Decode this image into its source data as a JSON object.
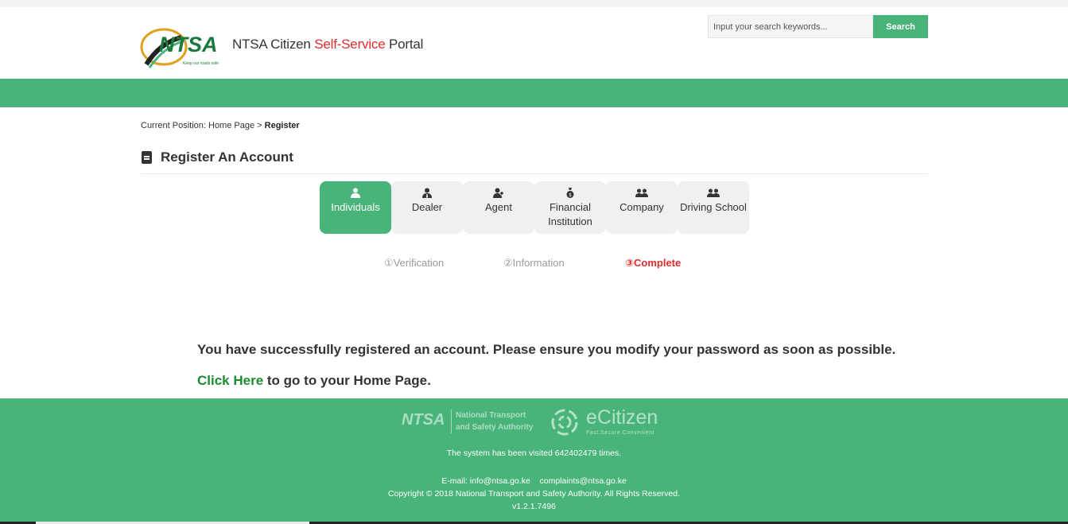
{
  "header": {
    "logo_text": "NTSA",
    "logo_tagline": "Keep our roads safe",
    "title_prefix": "NTSA Citizen ",
    "title_highlight": "Self-Service",
    "title_suffix": " Portal",
    "search_placeholder": "Input your search keywords...",
    "search_button": "Search"
  },
  "breadcrumb": {
    "label": "Current Position:",
    "home": "Home Page",
    "separator": ">",
    "current": "Register"
  },
  "page_title": "Register An Account",
  "tabs": [
    {
      "label": "Individuals",
      "icon": "person-icon",
      "active": true
    },
    {
      "label": "Dealer",
      "icon": "dealer-icon",
      "active": false
    },
    {
      "label": "Agent",
      "icon": "agent-icon",
      "active": false
    },
    {
      "label": "Financial Institution",
      "icon": "money-bag-icon",
      "active": false
    },
    {
      "label": "Company",
      "icon": "group-icon",
      "active": false
    },
    {
      "label": "Driving School",
      "icon": "group-icon",
      "active": false
    }
  ],
  "steps": [
    {
      "label": "①Verification",
      "current": false
    },
    {
      "label": "②Information",
      "current": false
    },
    {
      "label": "③Complete",
      "current": true
    }
  ],
  "message": {
    "success": "You have successfully registered an account. Please ensure you modify your password as soon as possible.",
    "link_text": "Click Here",
    "link_suffix": " to go to your Home Page."
  },
  "footer": {
    "ntsa_logo": "NTSA",
    "ntsa_name_line1": "National Transport",
    "ntsa_name_line2": "and Safety Authority",
    "ecitizen_name": "eCitizen",
    "ecitizen_tagline": "Fast.Secure.Convenient",
    "visits": "The system has been visited 642402479 times.",
    "email_label": "E-mail: info@ntsa.go.ke",
    "email_complaints": "complaints@ntsa.go.ke",
    "copyright": "Copyright © 2018 National Transport and Safety Authority. All Rights Reserved.",
    "version": "v1.2.1.7496"
  },
  "colors": {
    "brand_green": "#48b479",
    "highlight_red": "#e02b2b",
    "link_green": "#1e8c2e"
  }
}
